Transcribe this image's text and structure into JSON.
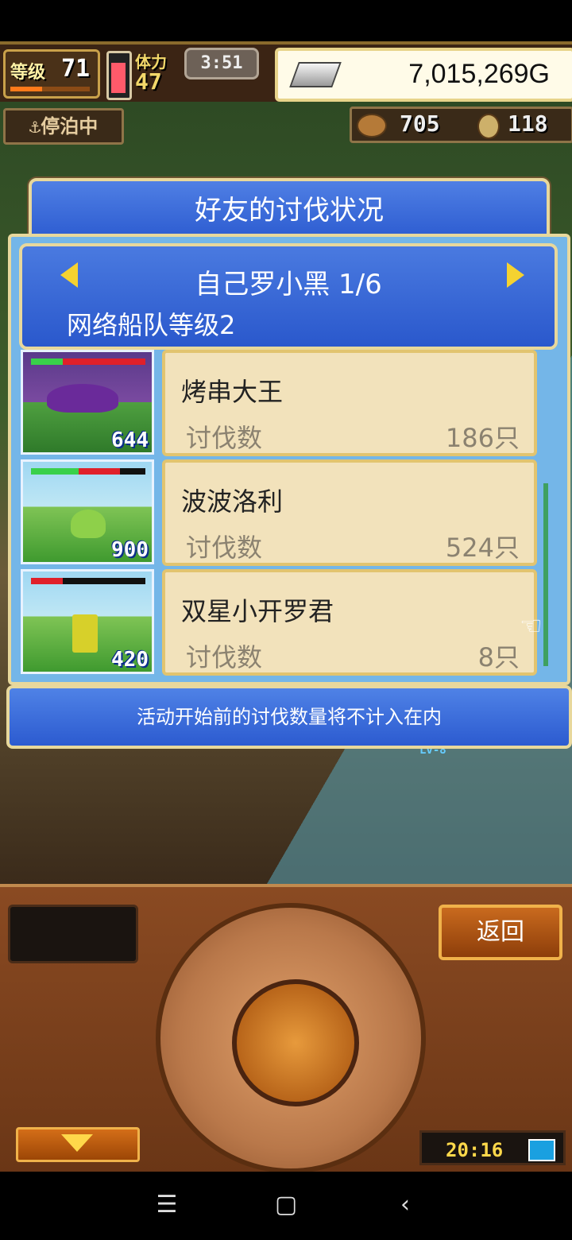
{
  "status_bar": {
    "level_label": "等级",
    "level_value": "71",
    "level_progress": 0.4,
    "stamina_label": "体力",
    "stamina_value": "47",
    "timer": "3:51",
    "gold": "7,015,269G"
  },
  "world": {
    "moored_label": "停泊中",
    "resource_1": "705",
    "resource_2": "118",
    "npc_level_tag": "Lv-8"
  },
  "dialog": {
    "title": "好友的讨伐状况",
    "friend_name": "自己罗小黑 1/6",
    "fleet_level": "网络船队等级2",
    "kill_label": "讨伐数",
    "bosses": [
      {
        "name": "烤串大王",
        "kills": "186只",
        "thumb_number": "644",
        "hp_fraction": 0.3
      },
      {
        "name": "波波洛利",
        "kills": "524只",
        "thumb_number": "900",
        "hp_fraction": 0.5
      },
      {
        "name": "双星小开罗君",
        "kills": "8只",
        "thumb_number": "420",
        "hp_fraction": 0.0
      }
    ],
    "note": "活动开始前的讨伐数量将不计入在内"
  },
  "controller": {
    "back_label": "返回",
    "clock": "20:16"
  },
  "nav": {
    "menu_icon": "☰",
    "home_icon": "▢",
    "back_icon": "‹"
  },
  "colors": {
    "dialog_blue": "#2c5bd0",
    "card_bg": "#f2e2bb",
    "gold_border": "#e8d89c"
  }
}
